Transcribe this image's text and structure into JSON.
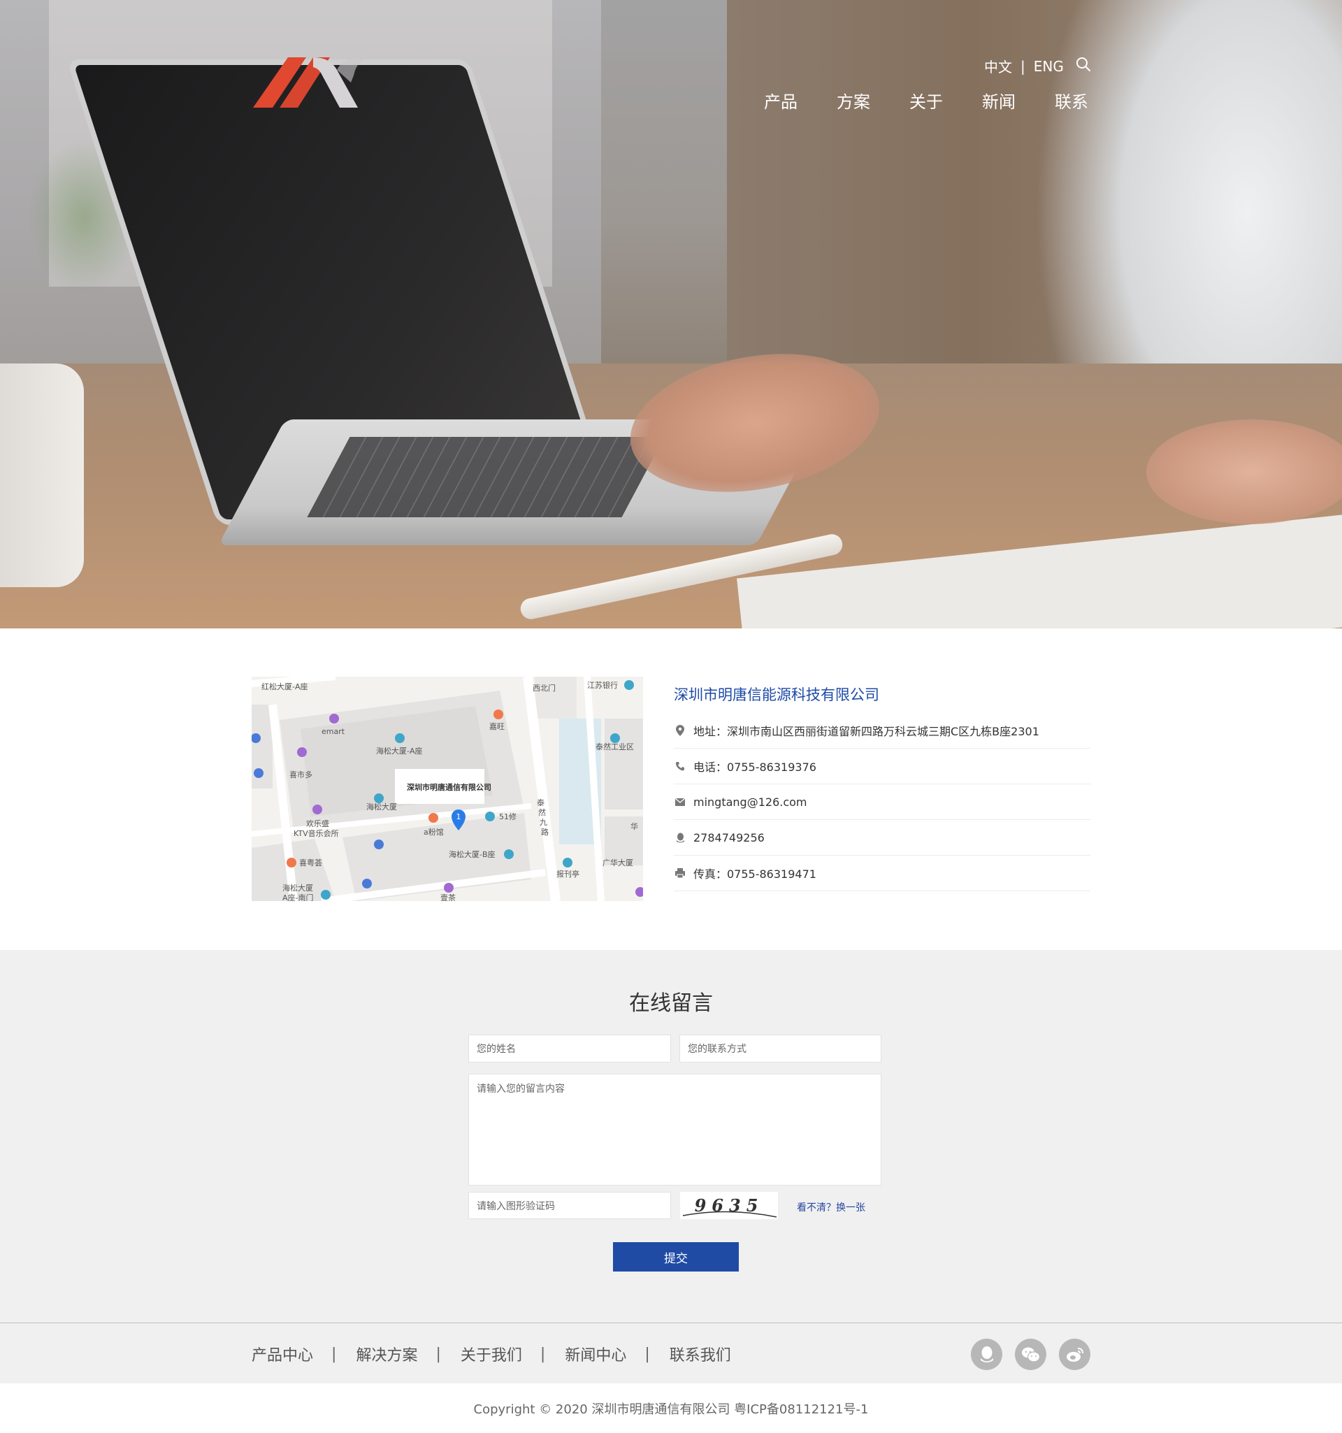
{
  "header": {
    "lang_zh": "中文",
    "lang_sep": "|",
    "lang_en": "ENG",
    "nav": [
      "产品",
      "方案",
      "关于",
      "新闻",
      "联系"
    ]
  },
  "contact": {
    "map_labels": {
      "l1": "红松大厦-A座",
      "l2": "西北门",
      "l3": "江苏银行",
      "l4": "emart",
      "l5": "嘉旺",
      "l6": "海松大厦-A座",
      "l7": "泰然工业区",
      "l8": "喜市多",
      "l9": "深圳市明唐通信有限公司",
      "l10": "海松大厦",
      "l11": "51修",
      "l12": "欢乐盛",
      "l13": "KTV音乐会所",
      "l14": "a粉馆",
      "l15": "泰",
      "l16": "然",
      "l17": "九",
      "l18": "路",
      "l19": "华",
      "l20": "海松大厦-B座",
      "l21": "喜粤荟",
      "l22": "广华大厦",
      "l23": "报刊亭",
      "l24": "海松大厦",
      "l25": "A座-南门",
      "l26": "壹茶",
      "marker": "1"
    },
    "company": "深圳市明唐信能源科技有限公司",
    "items": [
      {
        "icon": "location-icon",
        "text": "地址：深圳市南山区西丽街道留新四路万科云城三期C区九栋B座2301"
      },
      {
        "icon": "phone-icon",
        "text": "电话：0755-86319376"
      },
      {
        "icon": "mail-icon",
        "text": "mingtang@126.com"
      },
      {
        "icon": "qq-icon",
        "text": "2784749256"
      },
      {
        "icon": "fax-icon",
        "text": "传真：0755-86319471"
      }
    ]
  },
  "message": {
    "title": "在线留言",
    "name_placeholder": "您的姓名",
    "contact_placeholder": "您的联系方式",
    "content_placeholder": "请输入您的留言内容",
    "captcha_placeholder": "请输入图形验证码",
    "captcha_code": "9635",
    "captcha_refresh": "看不清？换一张",
    "submit": "提交"
  },
  "footer": {
    "nav": [
      "产品中心",
      "解决方案",
      "关于我们",
      "新闻中心",
      "联系我们"
    ],
    "sep": "|",
    "social_icons": [
      "qq-icon",
      "wechat-icon",
      "weibo-icon"
    ],
    "copyright": "Copyright © 2020 深圳市明唐通信有限公司 粤ICP备08112121号-1"
  },
  "colors": {
    "accent": "#1f4ba5",
    "company": "#1e4aa8",
    "logo_red": "#e0482f",
    "logo_grey": "#d5d3d6"
  }
}
